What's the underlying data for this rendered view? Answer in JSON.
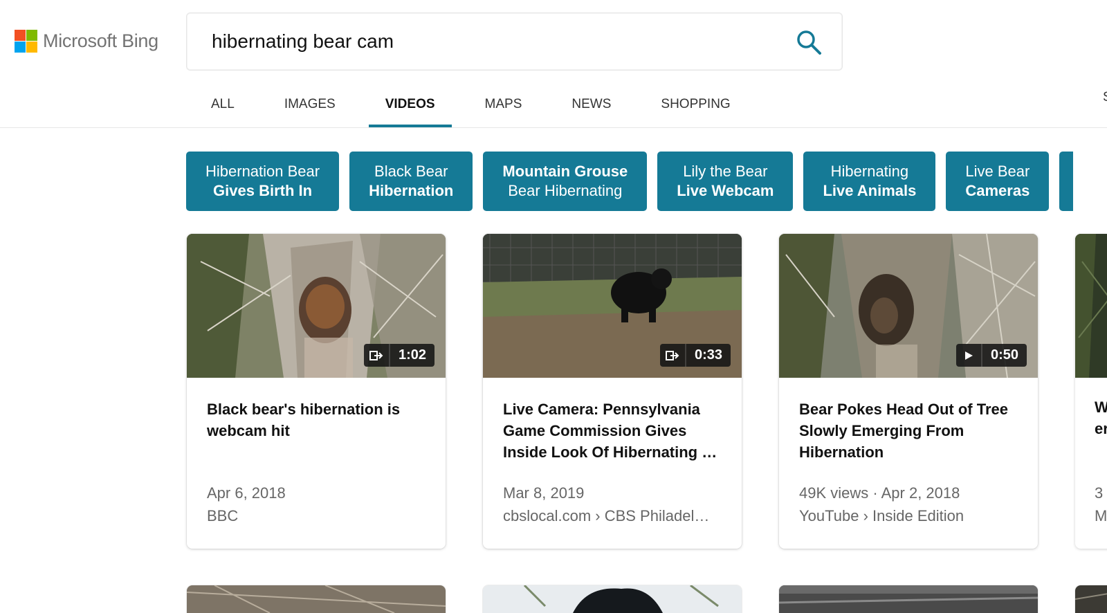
{
  "brand": {
    "name": "Microsoft Bing",
    "logo_colors": [
      "#f25022",
      "#7fba00",
      "#00a4ef",
      "#ffb900"
    ],
    "accent": "#157a96"
  },
  "search": {
    "query": "hibernating bear cam",
    "icon": "search-icon"
  },
  "tabs": [
    {
      "label": "ALL",
      "active": false
    },
    {
      "label": "IMAGES",
      "active": false
    },
    {
      "label": "VIDEOS",
      "active": true
    },
    {
      "label": "MAPS",
      "active": false
    },
    {
      "label": "NEWS",
      "active": false
    },
    {
      "label": "SHOPPING",
      "active": false
    }
  ],
  "tab_edge_fragment": "S",
  "chips": [
    {
      "line1": "Hibernation Bear",
      "line2": "Gives Birth In",
      "bold_line": 2
    },
    {
      "line1": "Black Bear",
      "line2": "Hibernation",
      "bold_line": 2
    },
    {
      "line1": "Mountain Grouse",
      "line2": "Bear Hibernating",
      "bold_line": 1
    },
    {
      "line1": "Lily the Bear",
      "line2": "Live Webcam",
      "bold_line": 2
    },
    {
      "line1": "Hibernating",
      "line2": "Live Animals",
      "bold_line": 2
    },
    {
      "line1": "Live Bear",
      "line2": "Cameras",
      "bold_line": 2
    }
  ],
  "videos": [
    {
      "duration": "1:02",
      "badge_icon": "share-icon",
      "title": "Black bear's hibernation is webcam hit",
      "meta1": "Apr 6, 2018",
      "meta2": "BBC"
    },
    {
      "duration": "0:33",
      "badge_icon": "share-icon",
      "title": "Live Camera: Pennsylvania Game Commission Gives Inside Look Of Hibernating …",
      "meta1": "Mar 8, 2019",
      "meta2": "cbslocal.com › CBS Philadel…"
    },
    {
      "duration": "0:50",
      "badge_icon": "play-icon",
      "title": "Bear Pokes Head Out of Tree Slowly Emerging From Hibernation",
      "meta1": "49K views · Apr 2, 2018",
      "meta2": "YouTube › Inside Edition"
    }
  ],
  "peek_card": {
    "title_fragment_1": "W",
    "title_fragment_2": "er",
    "meta_fragment_1": "3",
    "meta_fragment_2": "M"
  }
}
